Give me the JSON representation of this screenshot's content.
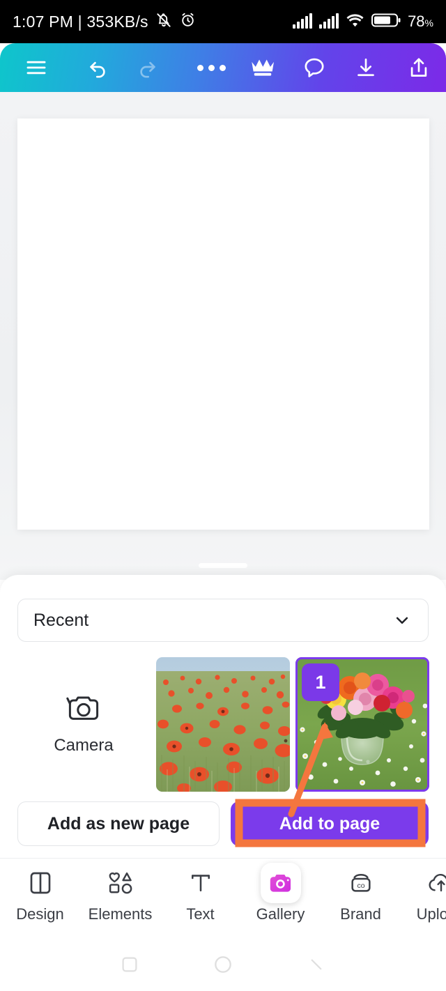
{
  "status_bar": {
    "time": "1:07 PM | 353KB/s",
    "mute_icon": "bell-muted-icon",
    "alarm_icon": "alarm-clock-icon",
    "signal_1_icon": "signal-bars-icon",
    "signal_2_icon": "signal-bars-icon",
    "wifi_icon": "wifi-icon",
    "battery_icon": "battery-icon",
    "battery_percent": "78",
    "battery_unit": "%"
  },
  "toolbar": {
    "menu_icon": "hamburger-menu-icon",
    "undo_icon": "undo-icon",
    "redo_icon": "redo-icon",
    "more_icon": "more-options-icon",
    "crown_icon": "crown-pro-icon",
    "comment_icon": "comment-icon",
    "download_icon": "download-icon",
    "share_icon": "share-icon",
    "gradient_start": "#0ec6cb",
    "gradient_end": "#7c2ae8"
  },
  "canvas": {
    "background": "#ffffff"
  },
  "sheet": {
    "drag_handle": "sheet-drag-handle",
    "source_select": {
      "value": "Recent",
      "chevron_icon": "chevron-down-icon"
    },
    "camera": {
      "icon": "camera-icon",
      "label": "Camera"
    },
    "thumbnails": [
      {
        "name": "poppy-field-photo",
        "selected": false,
        "badge": null
      },
      {
        "name": "rose-bouquet-photo",
        "selected": true,
        "badge": "1"
      }
    ],
    "buttons": {
      "secondary_label": "Add as new page",
      "primary_label": "Add to page",
      "primary_color": "#7b3beb"
    }
  },
  "bottom_nav": {
    "items": [
      {
        "label": "Design",
        "icon": "design-layout-icon",
        "active": false
      },
      {
        "label": "Elements",
        "icon": "elements-shapes-icon",
        "active": false
      },
      {
        "label": "Text",
        "icon": "text-t-icon",
        "active": false
      },
      {
        "label": "Gallery",
        "icon": "gallery-camera-icon",
        "active": true
      },
      {
        "label": "Brand",
        "icon": "brand-co-icon",
        "active": false
      },
      {
        "label": "Upload",
        "icon": "upload-cloud-icon",
        "active": false
      }
    ]
  },
  "system_nav": {
    "recents_icon": "recents-square-icon",
    "home_icon": "home-circle-icon",
    "back_icon": "back-chevron-icon"
  },
  "annotation": {
    "highlight_color": "#f4763e",
    "highlight_target": "Add to page",
    "arrow_from": "Add to page",
    "arrow_to": "rose-bouquet-photo"
  }
}
